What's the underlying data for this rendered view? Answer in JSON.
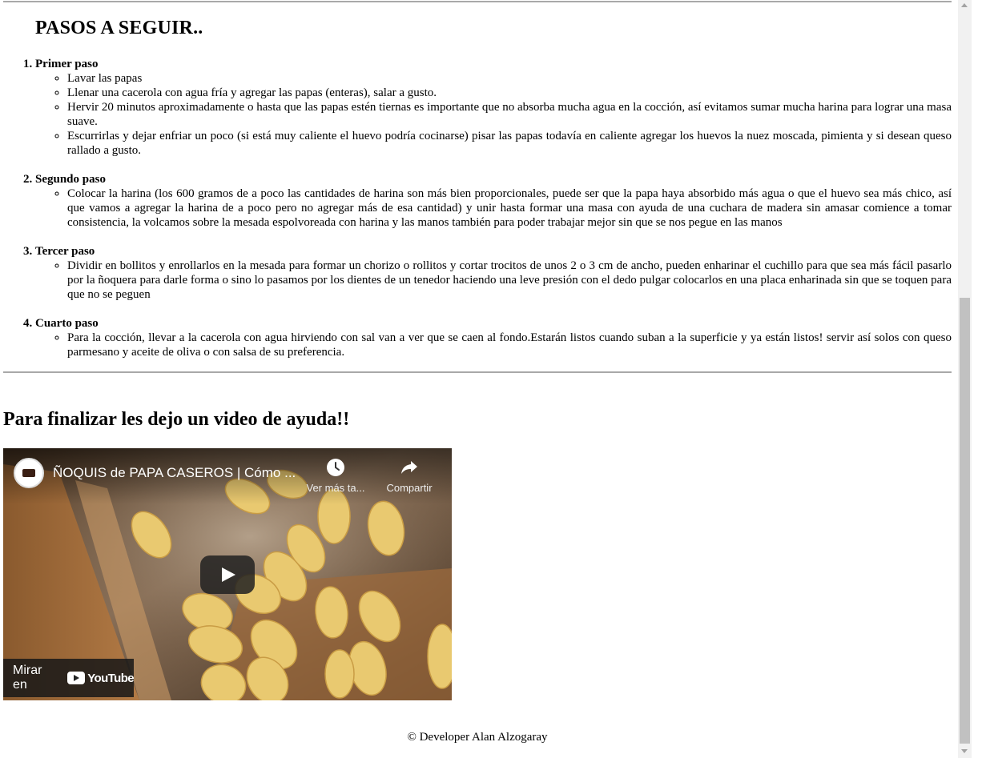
{
  "steps_title": "PASOS A SEGUIR..",
  "steps": [
    {
      "title": "Primer paso",
      "items": [
        "Lavar las papas",
        "Llenar una cacerola con agua fría y agregar las papas (enteras), salar a gusto.",
        "Hervir 20 minutos aproximadamente o hasta que las papas estén tiernas es importante que no absorba mucha agua en la cocción, así evitamos sumar mucha harina para lograr una masa suave.",
        "Escurrirlas y dejar enfriar un poco (si está muy caliente el huevo podría cocinarse) pisar las papas todavía en caliente agregar los huevos la nuez moscada, pimienta y si desean queso rallado a gusto."
      ]
    },
    {
      "title": "Segundo paso",
      "items": [
        "Colocar la harina (los 600 gramos de a poco las cantidades de harina son más bien proporcionales, puede ser que la papa haya absorbido más agua o que el huevo sea más chico, así que vamos a agregar la harina de a poco pero no agregar más de esa cantidad) y unir hasta formar una masa con ayuda de una cuchara de madera sin amasar comience a tomar consistencia, la volcamos sobre la mesada espolvoreada con harina y las manos también para poder trabajar mejor sin que se nos pegue en las manos"
      ]
    },
    {
      "title": "Tercer paso",
      "items": [
        "Dividir en bollitos y enrollarlos en la mesada para formar un chorizo o rollitos y cortar trocitos de unos 2 o 3 cm de ancho, pueden enharinar el cuchillo para que sea más fácil pasarlo por la ñoquera para darle forma o sino lo pasamos por los dientes de un tenedor haciendo una leve presión con el dedo pulgar colocarlos en una placa enharinada sin que se toquen para que no se peguen"
      ]
    },
    {
      "title": "Cuarto paso",
      "items": [
        "Para la cocción, llevar a la cacerola con agua hirviendo con sal van a ver que se caen al fondo.Estarán listos cuando suban a la superficie y ya están listos! servir así solos con queso parmesano y aceite de oliva o con salsa de su preferencia."
      ]
    }
  ],
  "video_section_title": "Para finalizar les dejo un video de ayuda!!",
  "video": {
    "title": "ÑOQUIS de PAPA CASEROS | Cómo ...",
    "watch_later": "Ver más ta...",
    "share": "Compartir",
    "watch_on": "Mirar en",
    "brand": "YouTube",
    "icons": [
      "clock-icon",
      "share-icon",
      "play-icon",
      "youtube-logo-icon"
    ]
  },
  "footer": "© Developer Alan Alzogaray"
}
